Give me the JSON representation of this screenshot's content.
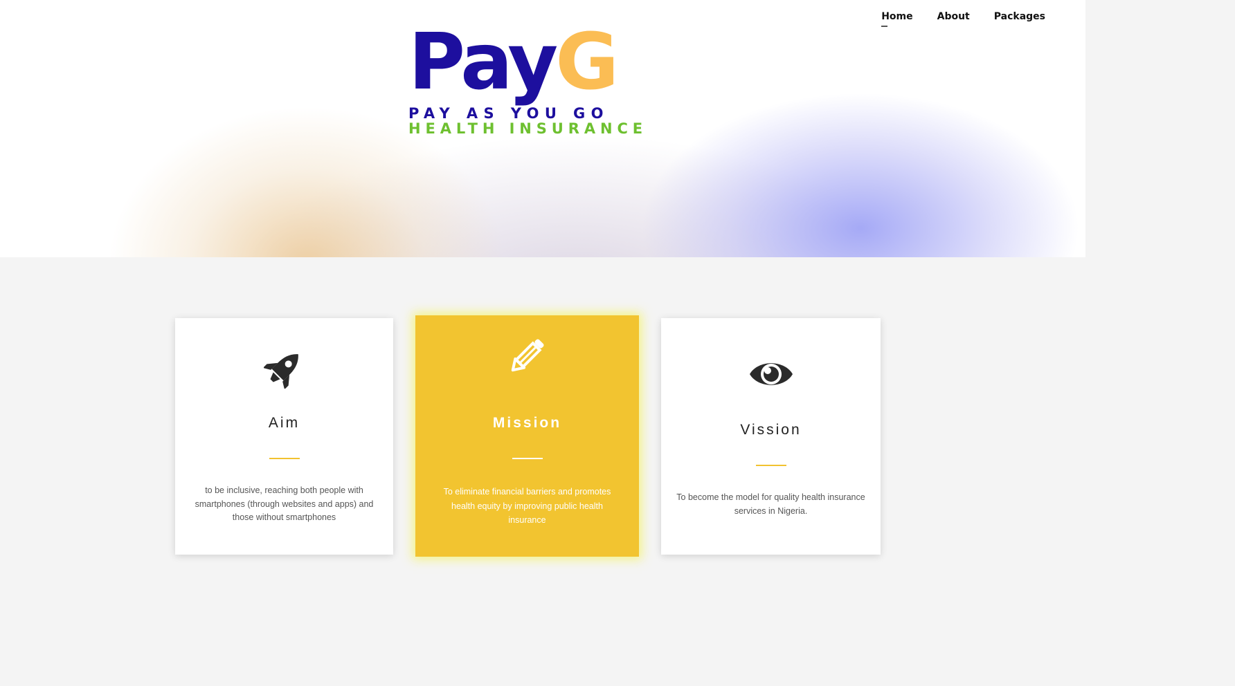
{
  "nav": {
    "items": [
      {
        "label": "Home",
        "active": true
      },
      {
        "label": "About",
        "active": false
      },
      {
        "label": "Packages",
        "active": false
      }
    ]
  },
  "logo": {
    "word_part1": "Pay",
    "word_part2": "G",
    "tagline_line1": "PAY AS YOU GO",
    "tagline_line2": "HEALTH INSURANCE",
    "colors": {
      "pay": "#1d0f9e",
      "g": "#fbbd54",
      "line2": "#6ec030"
    }
  },
  "cards": [
    {
      "icon": "rocket-icon",
      "title": "Aim",
      "text": "to be inclusive, reaching both people with smartphones (through websites and apps) and those without smartphones"
    },
    {
      "icon": "pencil-icon",
      "title": "Mission",
      "text": "To eliminate financial barriers and promotes health equity by improving public health insurance",
      "highlighted": true
    },
    {
      "icon": "eye-icon",
      "title": "Vission",
      "text": "To become the model for quality health insurance services in Nigeria."
    }
  ],
  "colors": {
    "accent": "#f2c430",
    "rule": "#f2c230",
    "page_bg": "#f4f4f4"
  }
}
